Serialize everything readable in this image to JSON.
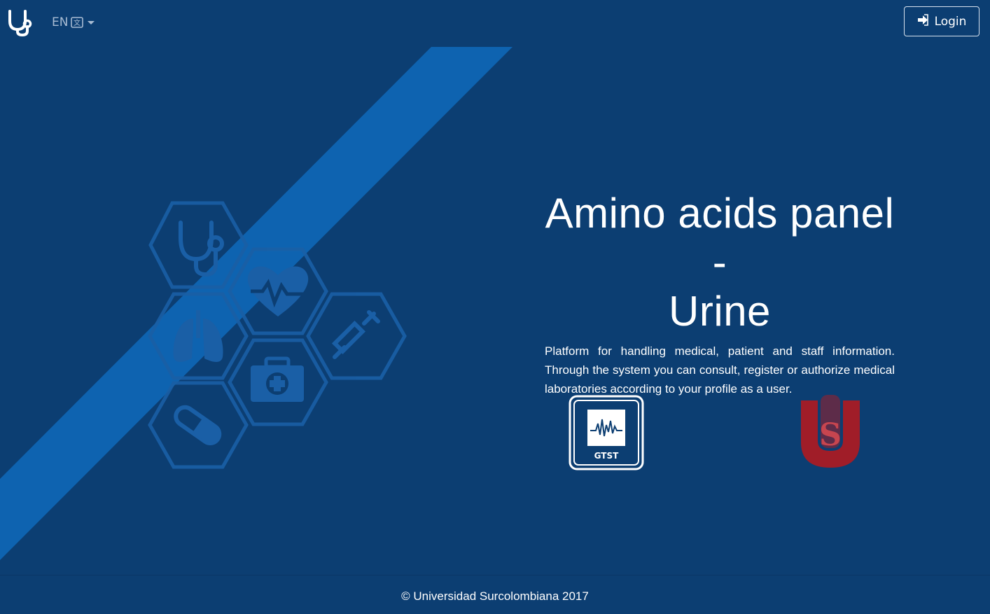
{
  "header": {
    "brand_icon": "stethoscope-icon",
    "language": {
      "code": "EN",
      "icon": "translate-icon"
    },
    "login": {
      "label": "Login",
      "icon": "sign-in-icon"
    }
  },
  "hero": {
    "title_line1": "Amino acids panel -",
    "title_line2": "Urine",
    "description": "Platform for handling medical, patient and staff information. Through the system you can consult, register or authorize medical laboratories according to your profile as a user."
  },
  "logos": {
    "gtst_label": "GTST",
    "usco_letter": "S"
  },
  "footer": {
    "copyright": "© Universidad Surcolombiana 2017"
  },
  "colors": {
    "background": "#0c3e72",
    "diagonal_band": "#0e63b0",
    "hex_outline": "#1660a8",
    "usco_red": "#a01d28"
  }
}
